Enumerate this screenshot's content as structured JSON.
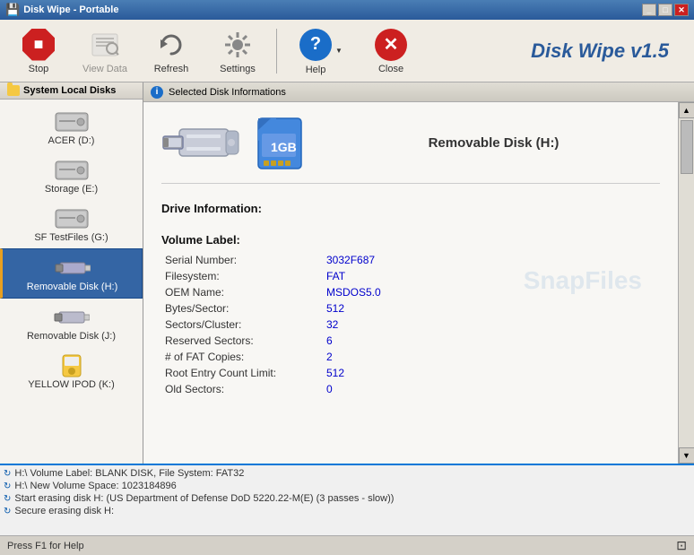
{
  "titleBar": {
    "icon": "💾",
    "title": "Disk Wipe - Portable",
    "buttons": [
      "_",
      "□",
      "✕"
    ]
  },
  "toolbar": {
    "stopLabel": "Stop",
    "viewDataLabel": "View Data",
    "refreshLabel": "Refresh",
    "settingsLabel": "Settings",
    "helpLabel": "Help",
    "closeLabel": "Close",
    "appTitle": "Disk Wipe v1.5"
  },
  "sidebar": {
    "header": "System Local Disks",
    "disks": [
      {
        "id": "acer",
        "label": "ACER (D:)",
        "selected": false
      },
      {
        "id": "storage",
        "label": "Storage (E:)",
        "selected": false
      },
      {
        "id": "sftestfiles",
        "label": "SF TestFiles (G:)",
        "selected": false
      },
      {
        "id": "removable-h",
        "label": "Removable Disk (H:)",
        "selected": true
      },
      {
        "id": "removable-j",
        "label": "Removable Disk (J:)",
        "selected": false
      },
      {
        "id": "yellow-ipod",
        "label": "YELLOW IPOD (K:)",
        "selected": false
      }
    ]
  },
  "panel": {
    "header": "Selected Disk Informations",
    "diskName": "Removable Disk  (H:)",
    "driveInfoHeading": "Drive Information:",
    "volumeLabelHeading": "Volume Label:",
    "watermark": "SnapFiles",
    "fields": [
      {
        "label": "Serial Number:",
        "value": "3032F687"
      },
      {
        "label": "Filesystem:",
        "value": "FAT"
      },
      {
        "label": "OEM Name:",
        "value": "MSDOS5.0"
      },
      {
        "label": "Bytes/Sector:",
        "value": "512"
      },
      {
        "label": "Sectors/Cluster:",
        "value": "32"
      },
      {
        "label": "Reserved Sectors:",
        "value": "6"
      },
      {
        "label": "# of FAT Copies:",
        "value": "2"
      },
      {
        "label": "Root Entry Count Limit:",
        "value": "512"
      },
      {
        "label": "Old Sectors:",
        "value": "0"
      }
    ]
  },
  "log": {
    "entries": [
      "H:\\ Volume Label: BLANK DISK, File System: FAT32",
      "H:\\ New Volume Space: 1023184896",
      "Start erasing disk H: (US Department of Defense DoD 5220.22-M(E) (3 passes - slow))",
      "Secure erasing disk H:"
    ]
  },
  "statusBar": {
    "helpText": "Press F1 for Help",
    "rightIcon": "⊡"
  }
}
